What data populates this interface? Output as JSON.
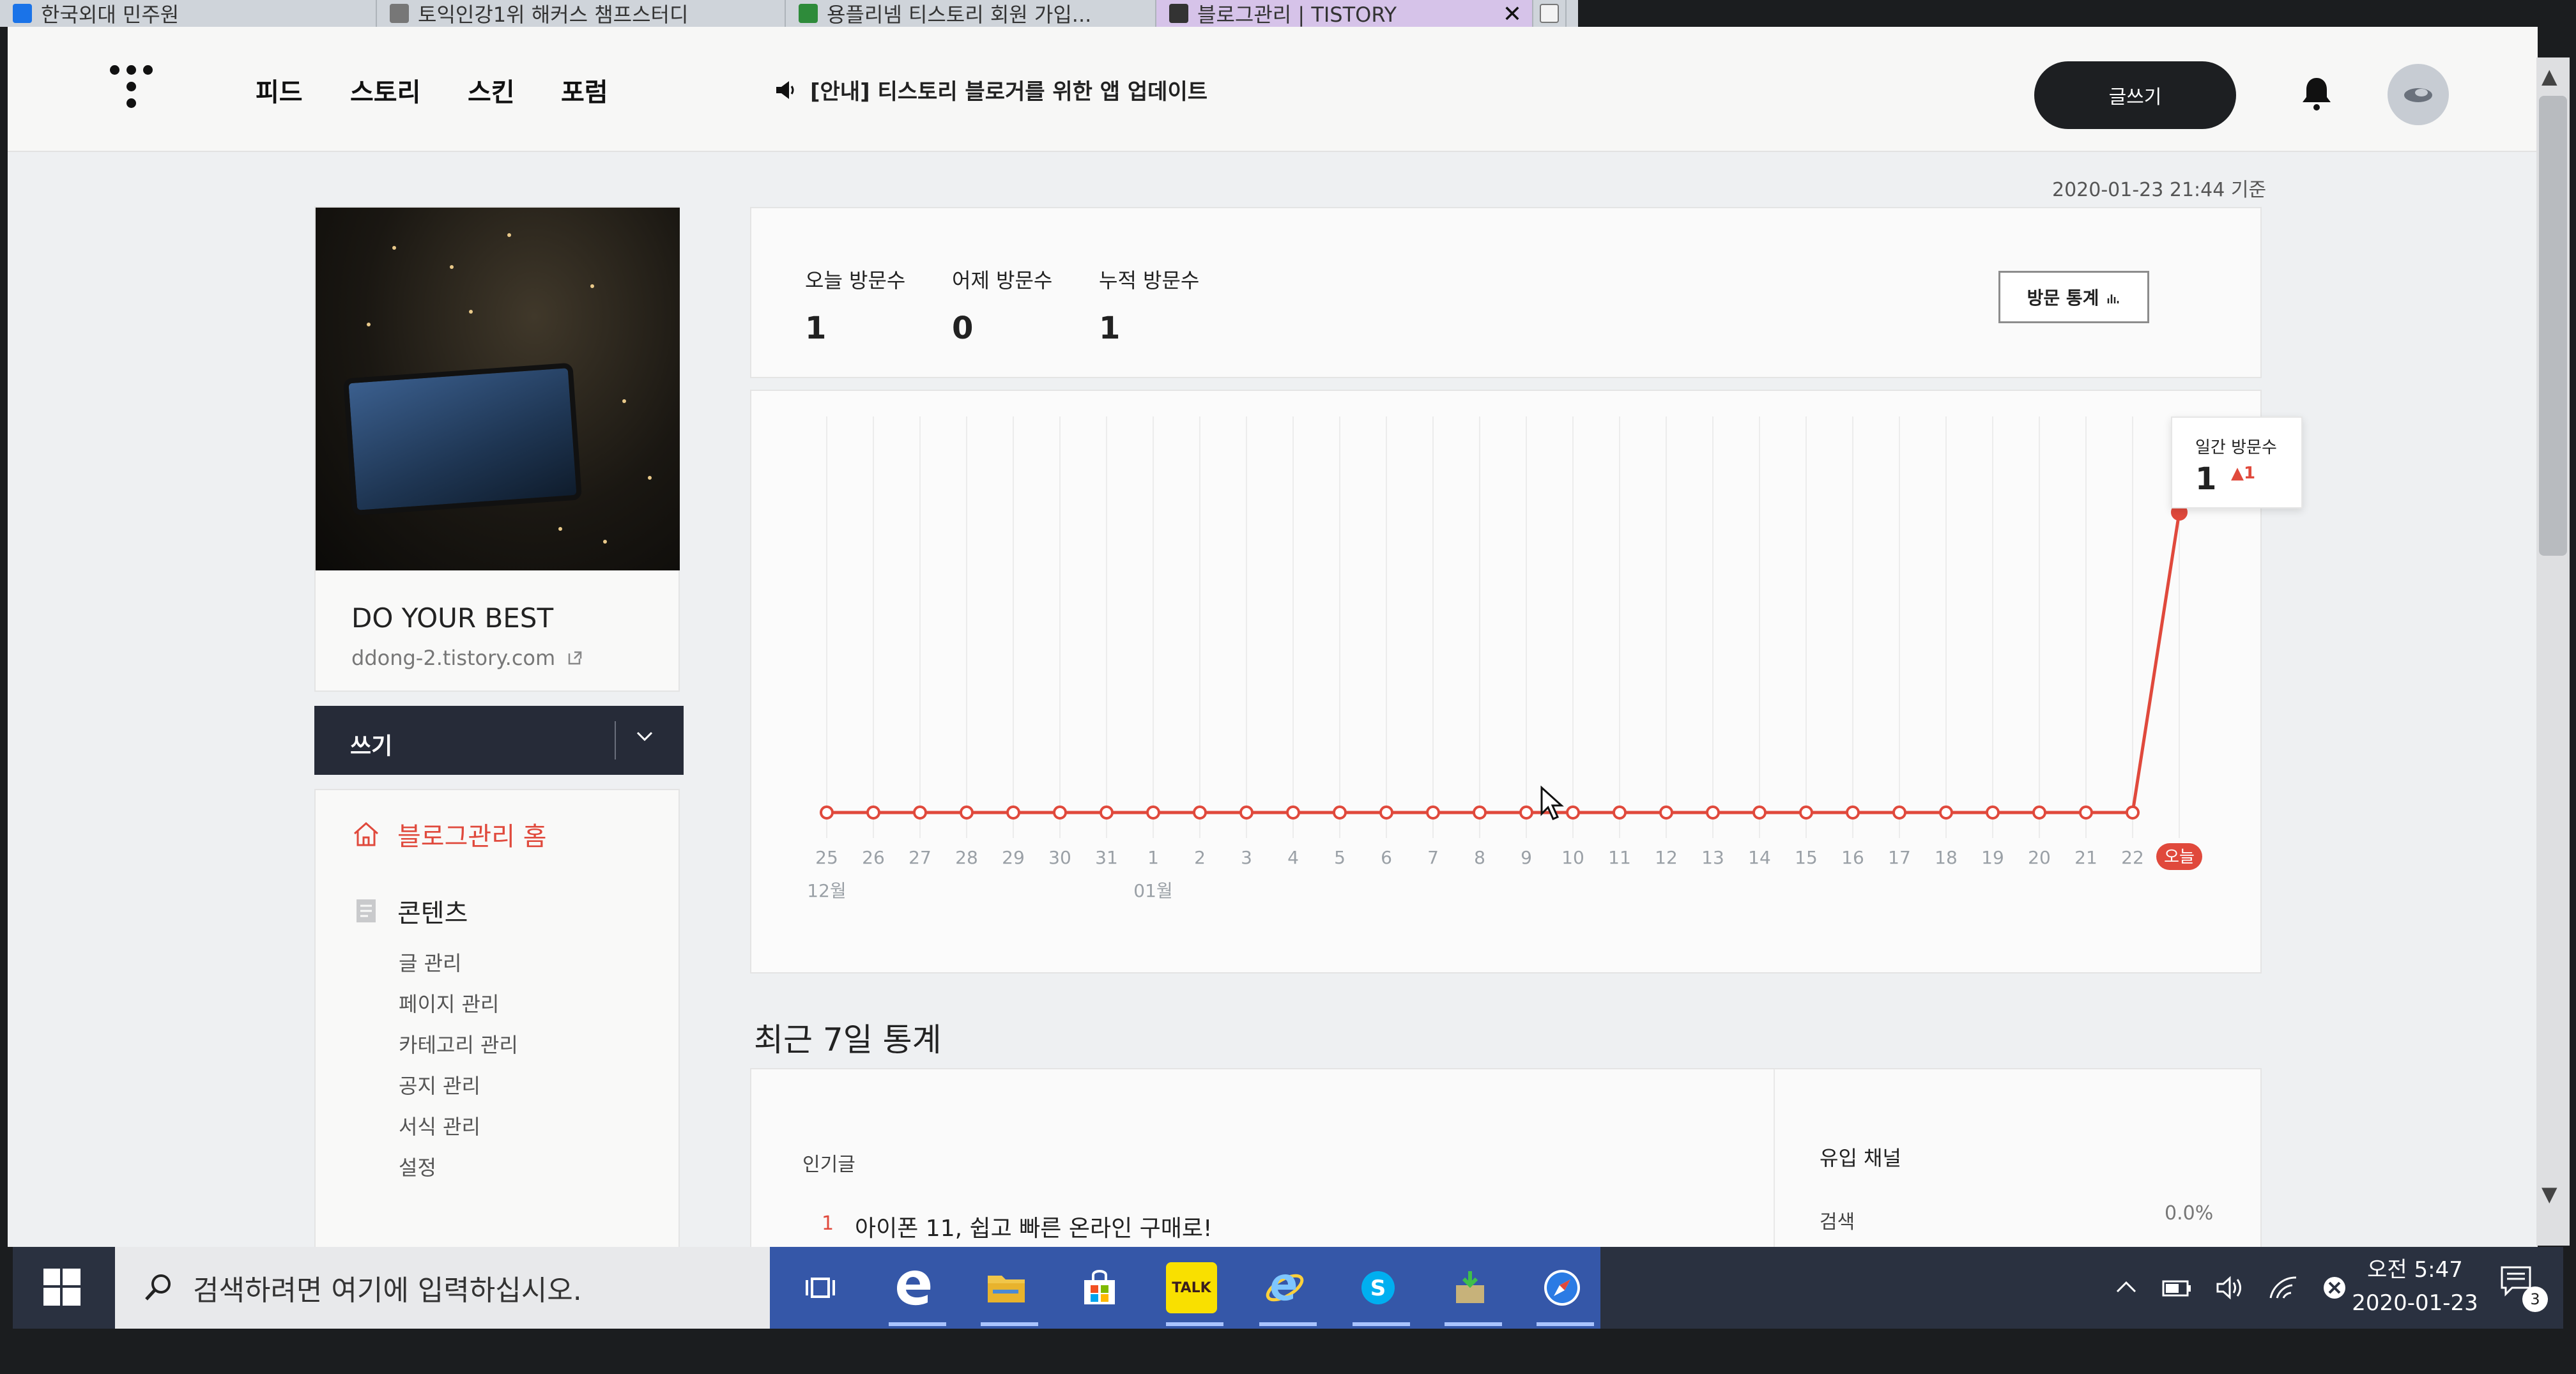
{
  "browser": {
    "tabs": [
      {
        "label": "한국외대 민주원",
        "active": false,
        "icon_color": "#1a73e8"
      },
      {
        "label": "토익인강1위 해커스 챔프스터디",
        "active": false,
        "icon_color": "#777777"
      },
      {
        "label": "용플리넴 티스토리 회원 가입...",
        "active": false,
        "icon_color": "#2e8b3a"
      },
      {
        "label": "블로그관리 | TISTORY",
        "active": true,
        "icon_color": "#333333"
      }
    ],
    "close_glyph": "✕"
  },
  "nav": {
    "links": [
      "피드",
      "스토리",
      "스킨",
      "포럼"
    ],
    "notice": "[안내] 티스토리 블로거를 위한 앱 업데이트",
    "write_button": "글쓰기"
  },
  "profile": {
    "blog_title": "DO YOUR BEST",
    "blog_url": "ddong-2.tistory.com"
  },
  "sidebar": {
    "write_menu": "쓰기",
    "home_label": "블로그관리 홈",
    "contents_label": "콘텐츠",
    "sub_items": [
      "글 관리",
      "페이지 관리",
      "카테고리 관리",
      "공지 관리",
      "서식 관리",
      "설정"
    ]
  },
  "main": {
    "timestamp": "2020-01-23 21:44 기준",
    "stats": [
      {
        "label": "오늘 방문수",
        "value": "1"
      },
      {
        "label": "어제 방문수",
        "value": "0"
      },
      {
        "label": "누적 방문수",
        "value": "1"
      }
    ],
    "stats_button": "방문 통계",
    "recent_title": "최근 7일 통계",
    "popular_label": "인기글",
    "popular_rank": "1",
    "popular_post": "아이폰 11, 쉽고 빠른 온라인 구매로!",
    "channel_label": "유입 채널",
    "channel_name": "검색",
    "channel_pct": "0.0%"
  },
  "chart_data": {
    "type": "line",
    "x": [
      "25",
      "26",
      "27",
      "28",
      "29",
      "30",
      "31",
      "1",
      "2",
      "3",
      "4",
      "5",
      "6",
      "7",
      "8",
      "9",
      "10",
      "11",
      "12",
      "13",
      "14",
      "15",
      "16",
      "17",
      "18",
      "19",
      "20",
      "21",
      "22",
      "오늘"
    ],
    "values": [
      0,
      0,
      0,
      0,
      0,
      0,
      0,
      0,
      0,
      0,
      0,
      0,
      0,
      0,
      0,
      0,
      0,
      0,
      0,
      0,
      0,
      0,
      0,
      0,
      0,
      0,
      0,
      0,
      0,
      1
    ],
    "month_labels": [
      {
        "at": "25",
        "label": "12월"
      },
      {
        "at": "1",
        "label": "01월"
      }
    ],
    "highlight_label": "오늘",
    "tooltip": {
      "label": "일간 방문수",
      "value": "1",
      "delta": "▲1"
    },
    "ylim": [
      0,
      1
    ],
    "colors": {
      "line": "#e0493c",
      "grid": "#ececec",
      "highlight_bg": "#e0493c"
    }
  },
  "taskbar": {
    "search_placeholder": "검색하려면 여기에 입력하십시오.",
    "apps": [
      "task-view",
      "edge",
      "file-explorer",
      "store",
      "kakaotalk",
      "internet-explorer",
      "skype",
      "installer",
      "safari"
    ],
    "kakao_label": "TALK",
    "clock_time": "오전 5:47",
    "clock_date": "2020-01-23",
    "notification_count": "3"
  }
}
